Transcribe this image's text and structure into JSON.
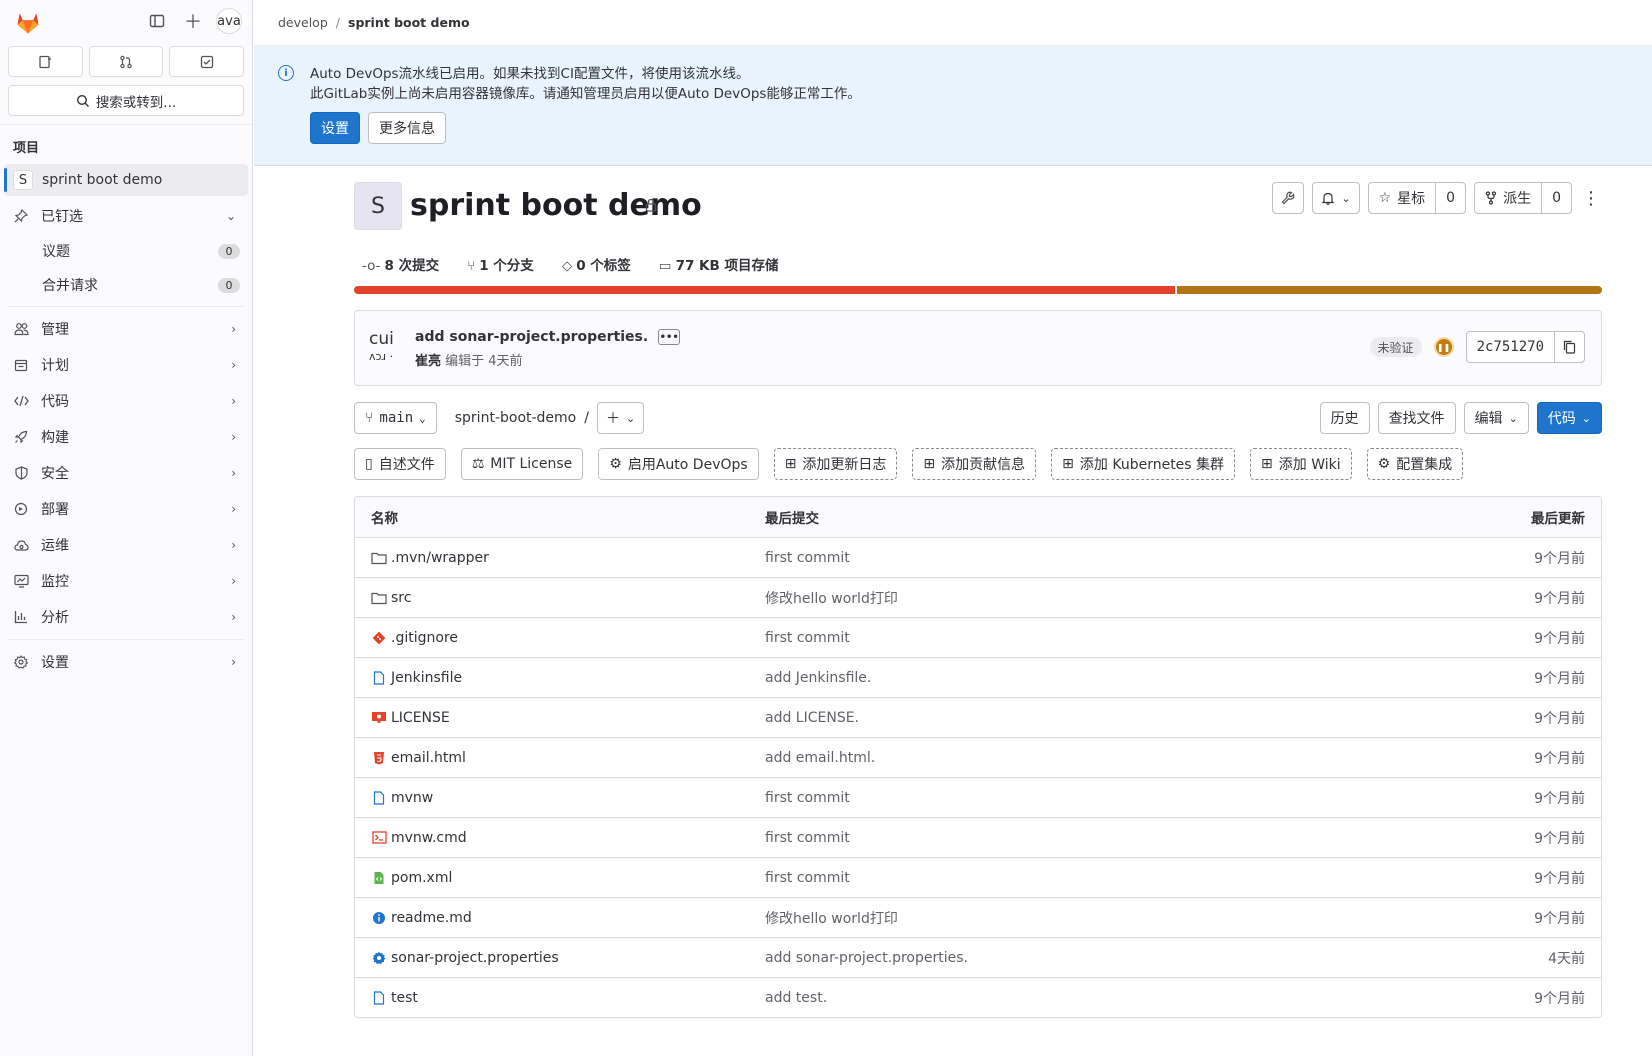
{
  "sidebar": {
    "avatar_text": "ava",
    "search_label": "搜索或转到...",
    "section_title": "项目",
    "project": {
      "letter": "S",
      "name": "sprint boot demo"
    },
    "pinned": {
      "label": "已钉选",
      "items": [
        {
          "label": "议题",
          "count": "0"
        },
        {
          "label": "合并请求",
          "count": "0"
        }
      ]
    },
    "nav": [
      {
        "label": "管理",
        "icon": "users-icon"
      },
      {
        "label": "计划",
        "icon": "calendar-icon"
      },
      {
        "label": "代码",
        "icon": "code-icon"
      },
      {
        "label": "构建",
        "icon": "rocket-icon"
      },
      {
        "label": "安全",
        "icon": "shield-icon"
      },
      {
        "label": "部署",
        "icon": "deployments-icon"
      },
      {
        "label": "运维",
        "icon": "cloud-gear-icon"
      },
      {
        "label": "监控",
        "icon": "monitor-icon"
      },
      {
        "label": "分析",
        "icon": "chart-icon"
      }
    ],
    "settings_label": "设置"
  },
  "breadcrumb": {
    "parent": "develop",
    "current": "sprint boot demo"
  },
  "alert": {
    "line1": "Auto DevOps流水线已启用。如果未找到CI配置文件，将使用该流水线。",
    "line2": "此GitLab实例上尚未启用容器镜像库。请通知管理员启用以便Auto DevOps能够正常工作。",
    "primary_button": "设置",
    "secondary_button": "更多信息"
  },
  "project": {
    "avatar_letter": "S",
    "title": "sprint boot demo",
    "star_label": "星标",
    "star_count": "0",
    "fork_label": "派生",
    "fork_count": "0",
    "stats": {
      "commits": "8 次提交",
      "branches": "1 个分支",
      "tags": "0 个标签",
      "storage": "77 KB 项目存储"
    },
    "language_share": 0.658,
    "colors": {
      "lang1": "#e24329",
      "lang2": "#b27516",
      "primary": "#1f75cb"
    }
  },
  "commit": {
    "avatar_text": "cui\n~~",
    "title": "add sonar-project.properties.",
    "author": "崔亮",
    "meta": "编辑于 4天前",
    "verify_badge": "未验证",
    "sha": "2c751270"
  },
  "tree": {
    "branch": "main",
    "path_root": "sprint-boot-demo",
    "path_sep": "/",
    "history": "历史",
    "find_file": "查找文件",
    "edit": "编辑",
    "code": "代码"
  },
  "quick_links": [
    "自述文件",
    "MIT License",
    "启用Auto DevOps",
    "添加更新日志",
    "添加贡献信息",
    "添加 Kubernetes 集群",
    "添加 Wiki",
    "配置集成"
  ],
  "files": {
    "headers": [
      "名称",
      "最后提交",
      "最后更新"
    ],
    "rows": [
      {
        "name": ".mvn/wrapper",
        "icon": "folder-icon",
        "commit": "first commit",
        "updated": "9个月前"
      },
      {
        "name": "src",
        "icon": "folder-icon",
        "commit": "修改hello world打印",
        "updated": "9个月前"
      },
      {
        "name": ".gitignore",
        "icon": "git-icon",
        "commit": "first commit",
        "updated": "9个月前"
      },
      {
        "name": "Jenkinsfile",
        "icon": "file-icon",
        "commit": "add Jenkinsfile.",
        "updated": "9个月前"
      },
      {
        "name": "LICENSE",
        "icon": "license-icon",
        "commit": "add LICENSE.",
        "updated": "9个月前"
      },
      {
        "name": "email.html",
        "icon": "html-icon",
        "commit": "add email.html.",
        "updated": "9个月前"
      },
      {
        "name": "mvnw",
        "icon": "file-icon",
        "commit": "first commit",
        "updated": "9个月前"
      },
      {
        "name": "mvnw.cmd",
        "icon": "terminal-icon",
        "commit": "first commit",
        "updated": "9个月前"
      },
      {
        "name": "pom.xml",
        "icon": "xml-icon",
        "commit": "first commit",
        "updated": "9个月前"
      },
      {
        "name": "readme.md",
        "icon": "info-icon",
        "commit": "修改hello world打印",
        "updated": "9个月前"
      },
      {
        "name": "sonar-project.properties",
        "icon": "gear-icon",
        "commit": "add sonar-project.properties.",
        "updated": "4天前"
      },
      {
        "name": "test",
        "icon": "file-icon",
        "commit": "add test.",
        "updated": "9个月前"
      }
    ]
  }
}
